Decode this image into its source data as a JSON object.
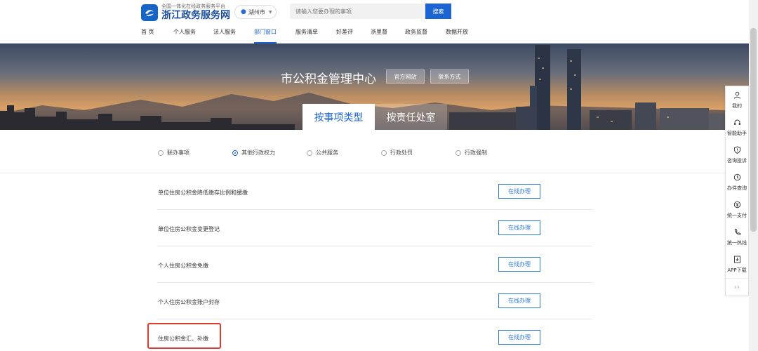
{
  "header": {
    "logo_subtitle": "全国一体化在线政务服务平台",
    "logo_title": "浙江政务服务网",
    "city": "湖州市",
    "search_placeholder": "请输入您要办理的事项",
    "search_button": "搜索",
    "nav": [
      "首 页",
      "个人服务",
      "法人服务",
      "部门窗口",
      "服务清单",
      "好差评",
      "浙里督",
      "政务监督",
      "数据开放"
    ],
    "nav_active_index": 3
  },
  "banner": {
    "title": "市公积金管理中心",
    "official_site": "官方网站",
    "contact": "联系方式",
    "tab_by_type": "按事项类型",
    "tab_by_office": "按责任处室"
  },
  "filters": {
    "options": [
      "联办事项",
      "其他行政权力",
      "公共服务",
      "行政处罚",
      "行政强制"
    ],
    "selected": "其他行政权力"
  },
  "items": [
    {
      "name": "单位住房公积金降低缴存比例和缓缴",
      "action": "在线办理"
    },
    {
      "name": "单位住房公积金变更登记",
      "action": "在线办理"
    },
    {
      "name": "个人住房公积金免缴",
      "action": "在线办理"
    },
    {
      "name": "个人住房公积金账户封存",
      "action": "在线办理"
    },
    {
      "name": "住房公积金汇、补缴",
      "action": "在线办理"
    }
  ],
  "sidebar": {
    "items": [
      {
        "label": "我的",
        "icon": "user-icon"
      },
      {
        "label": "智能助手",
        "icon": "headset-icon"
      },
      {
        "label": "咨询投诉",
        "icon": "shield-icon"
      },
      {
        "label": "办件查询",
        "icon": "history-icon"
      },
      {
        "label": "统一支付",
        "icon": "yuan-icon"
      },
      {
        "label": "统一热线",
        "icon": "phone-icon"
      },
      {
        "label": "APP下载",
        "icon": "download-icon"
      }
    ],
    "more": "››"
  },
  "colors": {
    "brand": "#1c64d4",
    "highlight": "#e03a2f"
  }
}
